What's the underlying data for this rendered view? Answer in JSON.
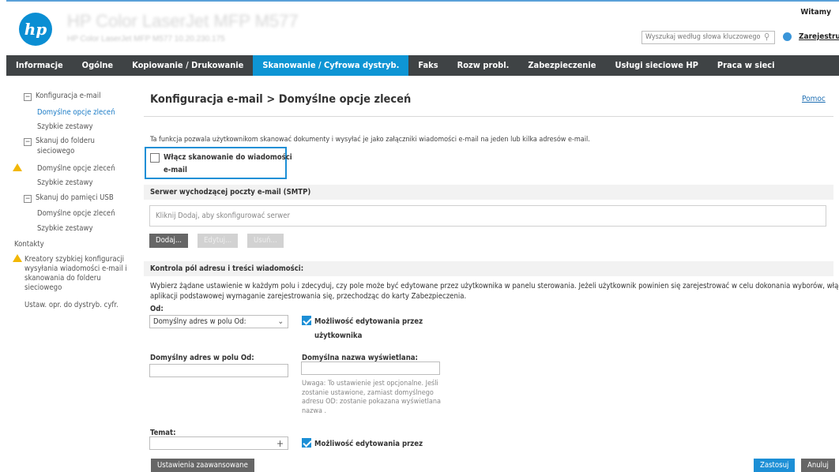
{
  "header": {
    "device_title": "HP Color LaserJet MFP M577",
    "device_subtitle": "HP Color LaserJet MFP M577    10.20.230.175",
    "welcome": "Witamy",
    "search_placeholder": "Wyszukaj według słowa kluczowego",
    "register": "Zarejestruj"
  },
  "nav": {
    "items": [
      "Informacje",
      "Ogólne",
      "Kopiowanie / Drukowanie",
      "Skanowanie / Cyfrowa dystryb.",
      "Faks",
      "Rozw probl.",
      "Zabezpieczenie",
      "Usługi sieciowe HP",
      "Praca w sieci"
    ],
    "active_index": 3
  },
  "sidebar": {
    "items": [
      {
        "label": "Konfiguracja e-mail"
      },
      {
        "label": "Domyślne opcje zleceń"
      },
      {
        "label": "Szybkie zestawy"
      },
      {
        "label": "Skanuj do folderu"
      },
      {
        "label": "sieciowego"
      },
      {
        "label": "Domyślne opcje zleceń"
      },
      {
        "label": "Szybkie zestawy"
      },
      {
        "label": "Skanuj do pamięci USB"
      },
      {
        "label": "Domyślne opcje zleceń"
      },
      {
        "label": "Szybkie zestawy"
      },
      {
        "label": "Kontakty"
      },
      {
        "label": "Kreatory szybkiej konfiguracji"
      },
      {
        "label": "wysyłania wiadomości e-mail i"
      },
      {
        "label": "skanowania do folderu"
      },
      {
        "label": "sieciowego"
      },
      {
        "label": "Ustaw. opr. do dystryb. cyfr."
      }
    ]
  },
  "main": {
    "title": "Konfiguracja e-mail > Domyślne opcje zleceń",
    "help": "Pomoc",
    "description": "Ta funkcja pozwala użytkownikom skanować dokumenty i wysyłać je jako załączniki wiadomości e-mail na jeden lub kilka adresów e-mail.",
    "enable_checkbox_line1": "Włącz skanowanie do wiadomości",
    "enable_checkbox_line2": "e-mail",
    "smtp_section": "Serwer wychodzącej poczty e-mail (SMTP)",
    "smtp_placeholder": "Kliknij Dodaj, aby skonfigurować serwer",
    "btn_add": "Dodaj...",
    "btn_edit": "Edytuj...",
    "btn_remove": "Usuń...",
    "address_section": "Kontrola pól adresu i treści wiadomości:",
    "address_desc_line1": "Wybierz żądane ustawienie w każdym polu i zdecyduj, czy pole może być edytowane przez użytkownika w panelu sterowania. Jeżeli użytkownik powinien się zarejestrować w celu dokonania wyborów, włącz w",
    "address_desc_line2": "aplikacji podstawowej wymaganie zarejestrowania się, przechodząc do karty Zabezpieczenia.",
    "from_label": "Od:",
    "from_select": "Domyślny adres w polu Od:",
    "editable_line1": "Możliwość edytowania przez",
    "editable_line2": "użytkownika",
    "default_from_label": "Domyślny adres w polu Od:",
    "display_name_label": "Domyślna nazwa wyświetlana:",
    "note": "Uwaga: To ustawienie jest opcjonalne. Jeśli zostanie ustawione, zamiast domyślnego adresu OD: zostanie pokazana wyświetlana nazwa .",
    "subject_label": "Temat:",
    "subject_plus": "+",
    "editable2": "Możliwość edytowania przez",
    "btn_advanced": "Ustawienia zaawansowane",
    "btn_apply": "Zastosuj",
    "btn_cancel": "Anuluj"
  },
  "colors": {
    "accent": "#1c8fd6",
    "nav_bg": "#3f4345",
    "warning": "#f2b705"
  }
}
